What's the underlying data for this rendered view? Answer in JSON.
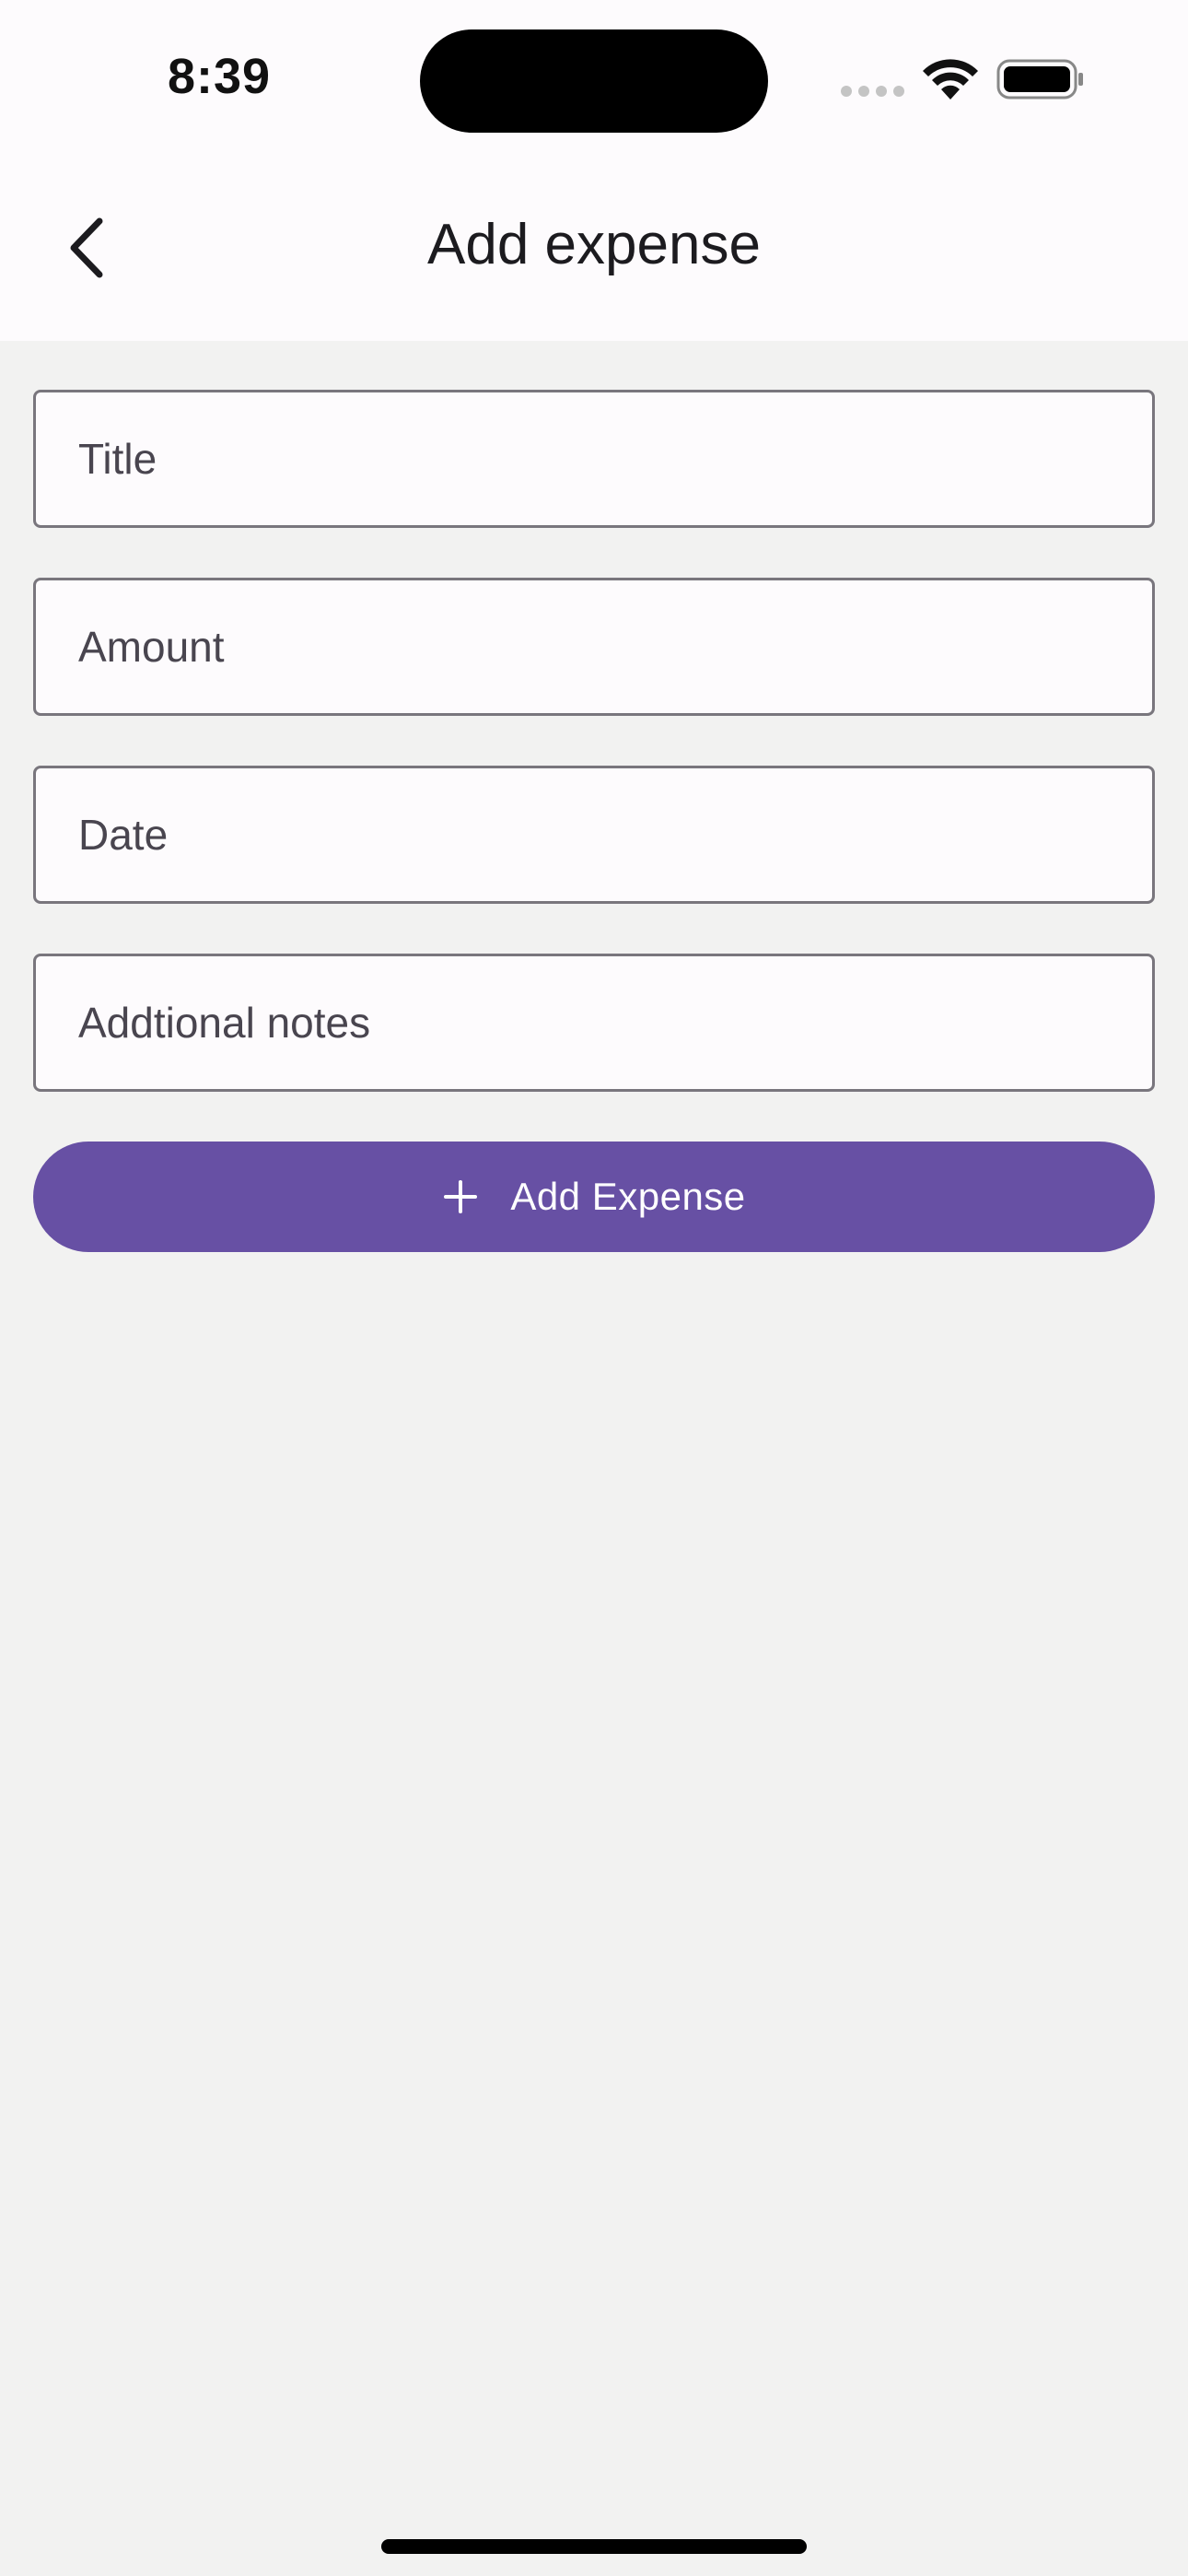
{
  "status_bar": {
    "time": "8:39",
    "icons": [
      "signal-dots-icon",
      "wifi-icon",
      "battery-icon"
    ]
  },
  "header": {
    "title": "Add expense",
    "back_icon": "chevron-left-icon"
  },
  "form": {
    "title_field": {
      "value": "",
      "placeholder": "Title"
    },
    "amount_field": {
      "value": "",
      "placeholder": "Amount"
    },
    "date_field": {
      "value": "",
      "placeholder": "Date"
    },
    "notes_field": {
      "value": "",
      "placeholder": "Addtional notes"
    },
    "submit_label": "Add Expense",
    "submit_icon": "plus-icon"
  },
  "colors": {
    "accent": "#6750a4",
    "background": "#f2f2f1",
    "surface": "#fdfbfd",
    "outline": "#79767d"
  }
}
